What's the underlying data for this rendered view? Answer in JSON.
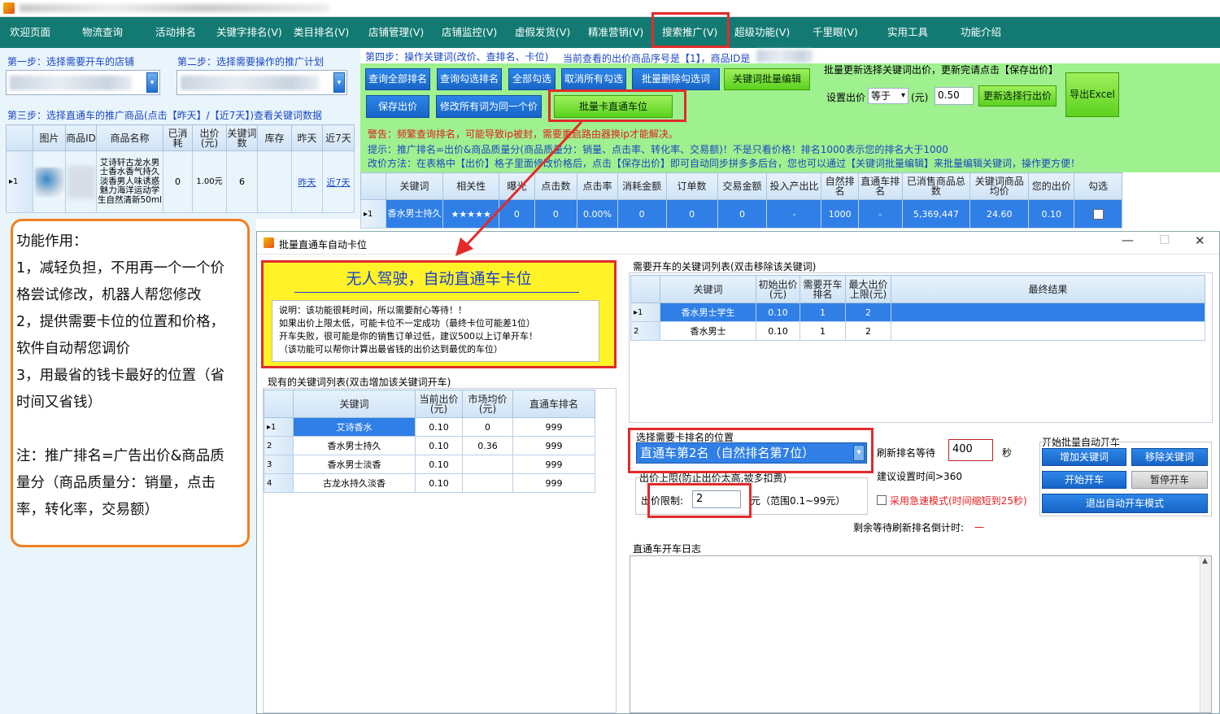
{
  "menu": [
    "欢迎页面",
    "物流查询",
    "活动排名",
    "关键字排名(V)",
    "类目排名(V)",
    "店铺管理(V)",
    "店铺监控(V)",
    "虚假发货(V)",
    "精准营销(V)",
    "搜索推广(V)",
    "超级功能(V)",
    "千里眼(V)",
    "实用工具",
    "功能介绍"
  ],
  "step1": "第一步：选择需要开车的店铺",
  "step2": "第二步：选择需要操作的推广计划",
  "step3": "第三步：选择直通车的推广商品(点击【昨天】/【近7天】)查看关键词数据",
  "step4": "第四步：操作关键词(改价、查排名、卡位)",
  "step4_note": "当前查看的出价商品序号是【1】，商品ID是",
  "buttons": {
    "query_all": "查询全部排名",
    "query_checked": "查询勾选排名",
    "select_all": "全部勾选",
    "cancel_all": "取消所有勾选",
    "batch_delete": "批量删除勾选词",
    "batch_edit": "关键词批量编辑",
    "save_bid": "保存出价",
    "set_same": "修改所有词为同一个价",
    "batch_card": "批量卡直通车位",
    "update_bid": "更新选择行出价",
    "export": "导出Excel"
  },
  "batch_hint": "批量更新选择关键词出价，更新完请点击【保存出价】",
  "set_bid_label": "设置出价",
  "set_bid_op": "等于",
  "set_bid_unit": "(元)",
  "set_bid_value": "0.50",
  "warning": "警告：频繁查询排名，可能导致ip被封，需要重启路由器换ip才能解决。",
  "tip1": "提示：推广排名=出价&商品质量分(商品质量分：销量、点击率、转化率、交易额)！不是只看价格！排名1000表示您的排名大于1000",
  "tip2": "改价方法：在表格中【出价】格子里面修改价格后，点击【保存出价】即可自动同步拼多多后台，您也可以通过【关键词批量编辑】来批量编辑关键词，操作更方便！",
  "product_table": {
    "headers": [
      "图片",
      "商品ID",
      "商品名称",
      "已消耗",
      "出价(元)",
      "关键词数",
      "库存",
      "昨天",
      "近7天"
    ],
    "row": {
      "idx": "1",
      "name": "艾诗轩古龙水男士香水香气持久淡香男人味诱惑魅力海洋运动学生自然清新50ml",
      "spent": "0",
      "bid": "1.00元",
      "kw": "6",
      "stock": "",
      "yesterday": "昨天",
      "week": "近7天"
    }
  },
  "kw_table": {
    "headers": [
      "关键词",
      "相关性",
      "曝光",
      "点击数",
      "点击率",
      "消耗金额",
      "订单数",
      "交易金额",
      "投入产出比",
      "自然排名",
      "直通车排名",
      "已消售商品总数",
      "关键词商品均价",
      "您的出价",
      "勾选"
    ],
    "row": {
      "idx": "1",
      "kw": "香水男士持久",
      "rel": "★★★★★",
      "exp": "0",
      "clicks": "0",
      "ctr": "0.00%",
      "spent": "0",
      "orders": "0",
      "amount": "0",
      "roi": "-",
      "natural": "1000",
      "ztc": "-",
      "sold": "5,369,447",
      "avg": "24.60",
      "bid": "0.10"
    }
  },
  "desc": {
    "title": "功能作用：",
    "l1": "1，减轻负担，不用再一个一个价",
    "l2": "格尝试修改，机器人帮您修改",
    "l3": "2，提供需要卡位的位置和价格，",
    "l4": "软件自动帮您调价",
    "l5": "3，用最省的钱卡最好的位置（省",
    "l6": "时间又省钱）",
    "n1": "注：推广排名=广告出价&商品质",
    "n2": "量分（商品质量分：销量，点击",
    "n3": "率，转化率，交易额）"
  },
  "dialog": {
    "title": "批量直通车自动卡位",
    "banner": "无人驾驶，自动直通车卡位",
    "notes": [
      "说明：该功能很耗时间，所以需要耐心等待！！",
      "如果出价上限太低，可能卡位不一定成功（最终卡位可能差1位）",
      "开车失败，很可能是你的销售订单过低，建议500以上订单开车！",
      "（该功能可以帮你计算出最省钱的出价达到最优的车位）"
    ],
    "need_list_title": "需要开车的关键词列表(双击移除该关键词)",
    "need_headers": [
      "关键词",
      "初始出价(元)",
      "需要开车排名",
      "最大出价上限(元)",
      "最终结果"
    ],
    "need_rows": [
      {
        "idx": "1",
        "kw": "香水男士学生",
        "init": "0.10",
        "rank": "1",
        "max": "2",
        "res": ""
      },
      {
        "idx": "2",
        "kw": "香水男士",
        "init": "0.10",
        "rank": "1",
        "max": "2",
        "res": ""
      }
    ],
    "have_list_title": "现有的关键词列表(双击增加该关键词开车)",
    "have_headers": [
      "关键词",
      "当前出价(元)",
      "市场均价(元)",
      "直通车排名"
    ],
    "have_rows": [
      {
        "idx": "1",
        "kw": "艾诗香水",
        "cur": "0.10",
        "avg": "0",
        "rank": "999"
      },
      {
        "idx": "2",
        "kw": "香水男士持久",
        "cur": "0.10",
        "avg": "0.36",
        "rank": "999"
      },
      {
        "idx": "3",
        "kw": "香水男士淡香",
        "cur": "0.10",
        "avg": "",
        "rank": "999"
      },
      {
        "idx": "4",
        "kw": "古龙水持久淡香",
        "cur": "0.10",
        "avg": "",
        "rank": "999"
      }
    ],
    "pos_label": "选择需要卡排名的位置",
    "pos_value": "直通车第2名（自然排名第7位）",
    "limit_title": "出价上限(防止出价太高,被多扣费)",
    "limit_label": "出价限制:",
    "limit_value": "2",
    "limit_range": "元（范围0.1~99元）",
    "refresh_label": "刷新排名等待",
    "refresh_value": "400",
    "refresh_unit": "秒",
    "suggest": "建议设置时间>360",
    "fast_mode": "采用急速模式(时间缩短到25秒)",
    "countdown_label": "剩余等待刷新排名倒计时:",
    "countdown_value": "一",
    "start_group": "开始批量自动开车",
    "btn_add": "增加关键词",
    "btn_remove": "移除关键词",
    "btn_start": "开始开车",
    "btn_pause": "暂停开车",
    "btn_exit": "退出自动开车模式",
    "log_title": "直通车开车日志"
  },
  "colors": {
    "menubar": "#127a72",
    "highlight": "#e32a2a",
    "accent": "#1f6fd1",
    "callout": "#f08020"
  }
}
